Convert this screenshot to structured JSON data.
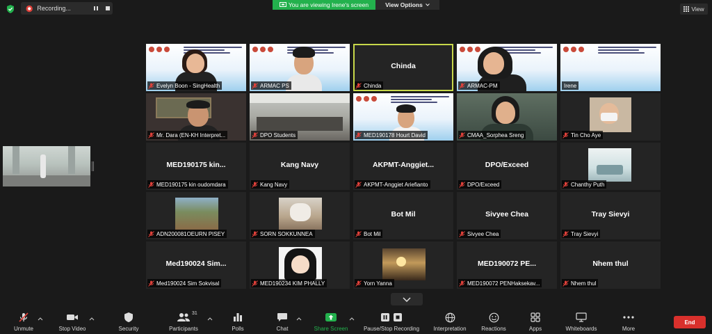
{
  "topbar": {
    "recording_label": "Recording...",
    "viewing_label": "You are viewing Irene's screen",
    "view_options_label": "View Options",
    "view_label": "View"
  },
  "tiles": [
    {
      "label": "Evelyn Boon - SingHealth",
      "big": ""
    },
    {
      "label": "ARMAC PS",
      "big": ""
    },
    {
      "label": "Chinda",
      "big": "Chinda"
    },
    {
      "label": "ARMAC-PM",
      "big": ""
    },
    {
      "label": "Irene",
      "big": ""
    },
    {
      "label": "Mr. Dara (EN-KH Interpret...",
      "big": ""
    },
    {
      "label": "DPO Students",
      "big": ""
    },
    {
      "label": "MED190178 Hourt David",
      "big": ""
    },
    {
      "label": "CMAA_Sorphea Sreng",
      "big": ""
    },
    {
      "label": "Tin Cho Aye",
      "big": ""
    },
    {
      "label": "MED190175 kin oudomdara",
      "big": "MED190175 kin..."
    },
    {
      "label": "Kang Navy",
      "big": "Kang Navy"
    },
    {
      "label": "AKPMT-Anggiet Ariefianto",
      "big": "AKPMT-Anggiet..."
    },
    {
      "label": "DPO/Exceed",
      "big": "DPO/Exceed"
    },
    {
      "label": "Chanthy Puth",
      "big": ""
    },
    {
      "label": "ADN200081OEURN PISEY",
      "big": ""
    },
    {
      "label": "SORN  SOKKUNNEA",
      "big": ""
    },
    {
      "label": "Bot Mil",
      "big": "Bot Mil"
    },
    {
      "label": "Sivyee Chea",
      "big": "Sivyee Chea"
    },
    {
      "label": "Tray Sievyi",
      "big": "Tray Sievyi"
    },
    {
      "label": "Med190024 Sim Sokvisal",
      "big": "Med190024 Sim..."
    },
    {
      "label": "MED190234 KIM PHALLY",
      "big": ""
    },
    {
      "label": "Yorn Yanna",
      "big": ""
    },
    {
      "label": "MED190072 PENHaksekav...",
      "big": "MED190072 PE..."
    },
    {
      "label": "Nhem thul",
      "big": "Nhem thul"
    }
  ],
  "toolbar": {
    "unmute": "Unmute",
    "stop_video": "Stop Video",
    "security": "Security",
    "participants": "Participants",
    "participants_count": "31",
    "polls": "Polls",
    "chat": "Chat",
    "share_screen": "Share Screen",
    "pause_recording": "Pause/Stop Recording",
    "interpretation": "Interpretation",
    "reactions": "Reactions",
    "apps": "Apps",
    "whiteboards": "Whiteboards",
    "more": "More",
    "end": "End"
  },
  "colors": {
    "share_green": "#23b14d",
    "end_red": "#d9302c",
    "active_speaker": "#c8d84a",
    "mic_muted_red": "#e0413a"
  }
}
